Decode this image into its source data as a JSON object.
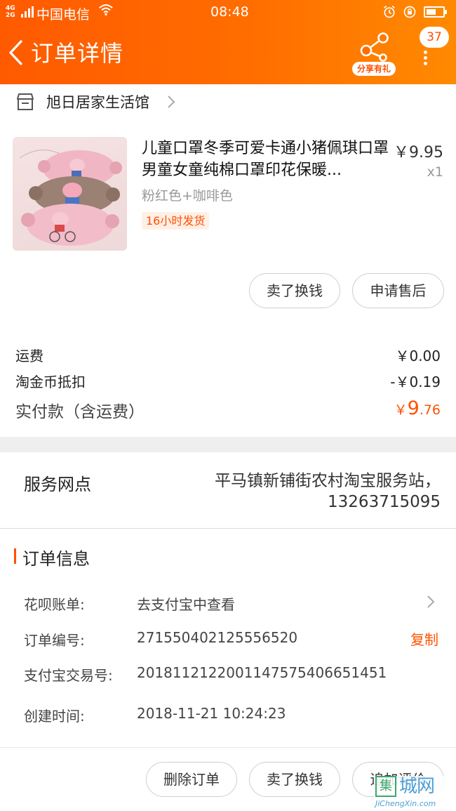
{
  "status_bar": {
    "network": "4G",
    "network2": "2G",
    "carrier": "中国电信",
    "time": "08:48",
    "icons": [
      "wifi-icon",
      "alarm-icon",
      "rotation-lock-icon",
      "battery-icon"
    ]
  },
  "nav": {
    "title": "订单详情",
    "share_label": "分享有礼",
    "badge_count": "37",
    "icons": [
      "back-arrow-icon",
      "share-icon",
      "more-vertical-icon"
    ]
  },
  "shop": {
    "name": "旭日居家生活馆",
    "icon": "store-icon"
  },
  "product": {
    "title": "儿童口罩冬季可爱卡通小猪佩琪口罩男童女童纯棉口罩印花保暖...",
    "price": "￥9.95",
    "quantity": "x1",
    "spec": "粉红色+咖啡色",
    "ship_tag": "16小时发货"
  },
  "item_actions": {
    "sell": "卖了换钱",
    "after_sale": "申请售后"
  },
  "fees": {
    "shipping_label": "运费",
    "shipping_value": "￥0.00",
    "coin_label": "淘金币抵扣",
    "coin_value": "-￥0.19",
    "paid_label": "实付款（含运费）",
    "paid_currency": "￥",
    "paid_int": "9",
    "paid_dec": ".76"
  },
  "service": {
    "label": "服务网点",
    "value": "平马镇新铺街农村淘宝服务站，13263715095"
  },
  "order_info": {
    "title": "订单信息",
    "rows": [
      {
        "label": "花呗账单:",
        "value": "去支付宝中查看"
      },
      {
        "label": "订单编号:",
        "value": "271550402125556520"
      },
      {
        "label": "支付宝交易号:",
        "value": "2018112122001147575406651451"
      },
      {
        "label": "创建时间:",
        "value": "2018-11-21 10:24:23"
      }
    ],
    "copy_label": "复制"
  },
  "bottom_actions": {
    "delete": "删除订单",
    "sell": "卖了换钱",
    "review": "追加评价"
  },
  "watermark": {
    "char": "集",
    "cn": "城网",
    "en": "JiChengXin.com"
  },
  "colors": {
    "accent": "#ff5000",
    "header_start": "#ff5a00",
    "header_end": "#ff8a00"
  }
}
